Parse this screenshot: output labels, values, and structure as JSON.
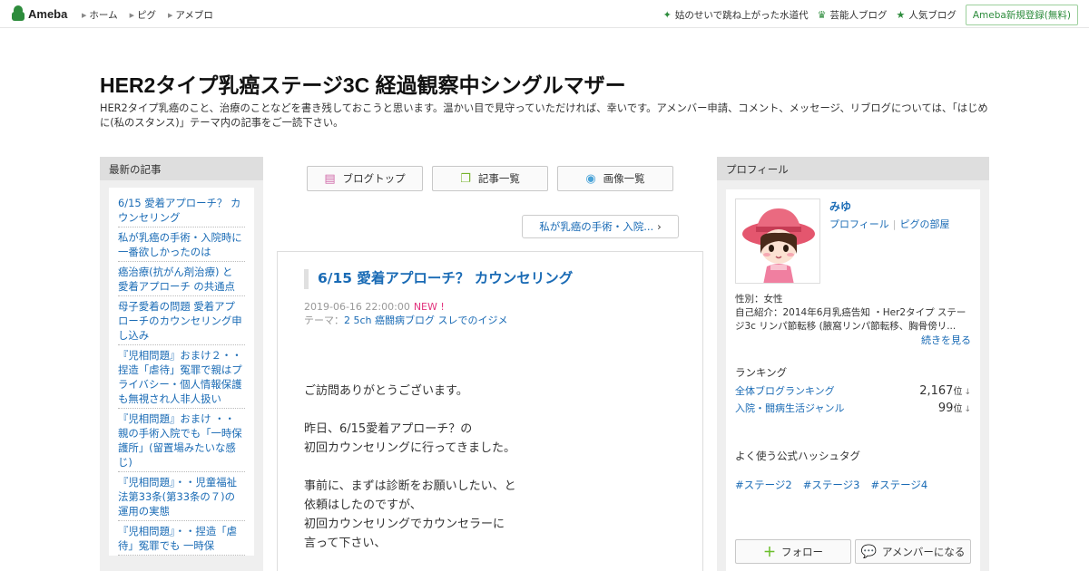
{
  "topbar": {
    "logo_text": "Ameba",
    "nav": [
      "ホーム",
      "ピグ",
      "アメブロ"
    ],
    "right_links": [
      {
        "icon": "sparkle-icon",
        "label": "姑のせいで跳ね上がった水道代"
      },
      {
        "icon": "crown-icon",
        "label": "芸能人ブログ"
      },
      {
        "icon": "star-icon",
        "label": "人気ブログ"
      }
    ],
    "register_label": "Ameba新規登録(無料)"
  },
  "blog": {
    "title": "HER2タイプ乳癌ステージ3C 経過観察中シングルマザー",
    "description": "HER2タイプ乳癌のこと、治療のことなどを書き残しておこうと思います。温かい目で見守っていただければ、幸いです。アメンバー申請、コメント、メッセージ、リブログについては、「はじめに(私のスタンス)」テーマ内の記事をご一読下さい。"
  },
  "left_sidebar": {
    "heading": "最新の記事",
    "entries": [
      "6/15 愛着アプローチ？ カウンセリング",
      "私が乳癌の手術・入院時に一番欲しかったのは",
      "癌治療(抗がん剤治療) と 愛着アプローチ の共通点",
      "母子愛着の問題 愛着アプローチのカウンセリング申し込み",
      "『児相問題』おまけ２・・捏造「虐待」冤罪で親はプライバシー・個人情報保護も無視され人非人扱い",
      "『児相問題』おまけ ・・親の手術入院でも「一時保護所」(留置場みたいな感じ)",
      "『児相問題』・・児童福祉法第33条(第33条の７)の運用の実態",
      "『児相問題』・・捏造「虐待」冤罪でも 一時保"
    ]
  },
  "tabs": [
    {
      "icon": "document-icon",
      "label": "ブログトップ"
    },
    {
      "icon": "copy-icon",
      "label": "記事一覧"
    },
    {
      "icon": "camera-icon",
      "label": "画像一覧"
    }
  ],
  "prev_article_label": "私が乳癌の手術・入院...",
  "article": {
    "title": "6/15 愛着アプローチ？ カウンセリング",
    "date": "2019-06-16 22:00:00",
    "new_badge": "NEW !",
    "theme_label": "テーマ：",
    "theme": "2 5ch 癌闘病ブログ スレでのイジメ",
    "paragraphs": [
      [
        "ご訪問ありがとうございます。"
      ],
      [
        "昨日、6/15愛着アプローチ？の",
        "初回カウンセリングに行ってきました。"
      ],
      [
        "事前に、まずは診断をお願いしたい、と",
        "依頼はしたのですが、",
        "初回カウンセリングでカウンセラーに",
        "言って下さい、"
      ]
    ]
  },
  "right_sidebar": {
    "heading": "プロフィール",
    "name": "みゆ",
    "link_profile": "プロフィール",
    "link_pig": "ピグの部屋",
    "gender": "性別：女性",
    "intro": "自己紹介：2014年6月乳癌告知 ・Her2タイプ ステージ3c リンパ節転移 (腋窩リンパ節転移、胸骨傍リ...",
    "more_label": "続きを見る",
    "ranking_title": "ランキング",
    "rankings": [
      {
        "label": "全体ブログランキング",
        "value": "2,167",
        "unit": "位"
      },
      {
        "label": "入院・闘病生活ジャンル",
        "value": "99",
        "unit": "位"
      }
    ],
    "hashtag_title": "よく使う公式ハッシュタグ",
    "hashtags": [
      "#ステージ2",
      "#ステージ3",
      "#ステージ4"
    ],
    "follow_label": "フォロー",
    "amember_label": "アメンバーになる"
  },
  "colors": {
    "link": "#1a6bb5",
    "brand_green": "#2d8c3c",
    "new_badge": "#e2337d"
  }
}
